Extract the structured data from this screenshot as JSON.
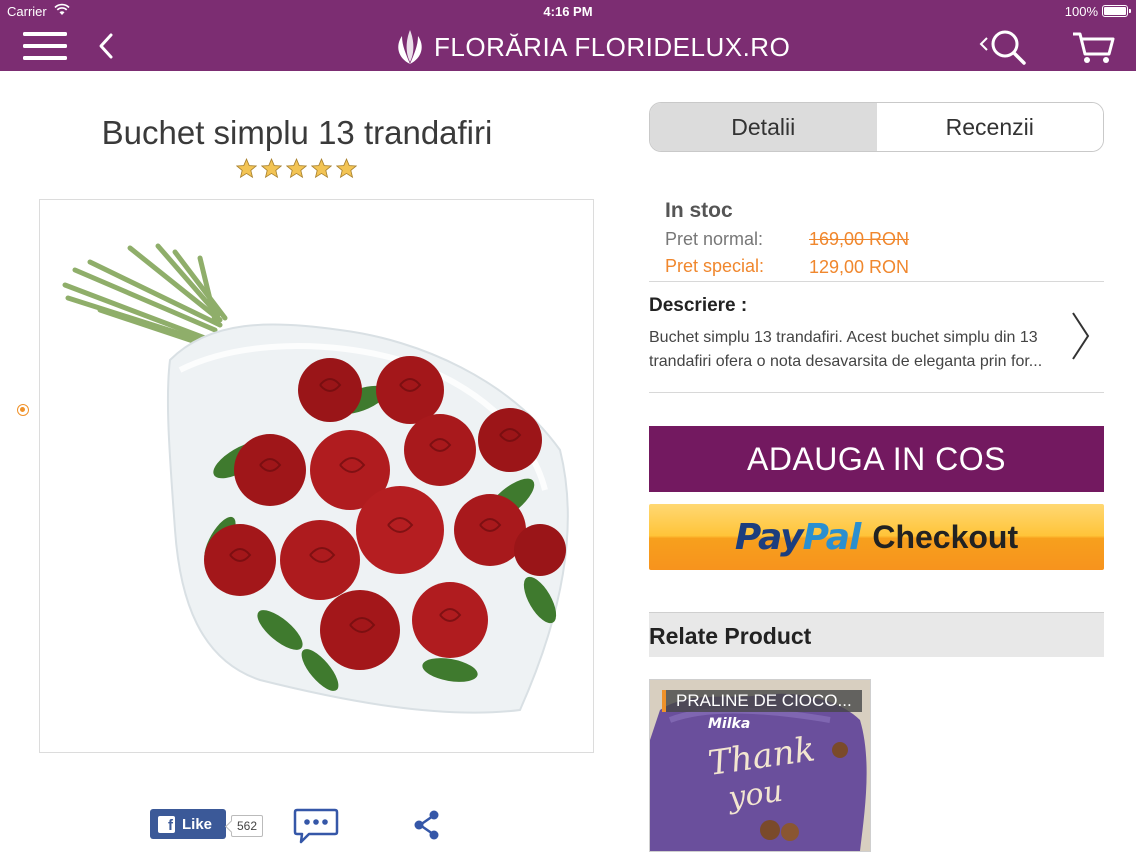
{
  "status_bar": {
    "carrier": "Carrier",
    "time": "4:16 PM",
    "battery": "100%"
  },
  "header": {
    "brand_name": "FLORĂRIA FLORIDELUX.RO",
    "icons": [
      "menu-icon",
      "back-icon",
      "logo-icon",
      "search-icon",
      "cart-icon"
    ],
    "background_color": "#7c2d72"
  },
  "product": {
    "title": "Buchet simplu 13 trandafiri",
    "rating": 5,
    "rating_max": 5,
    "page_indicator_count": 1
  },
  "social": {
    "like_label": "Like",
    "like_count": "562"
  },
  "tabs": [
    {
      "label": "Detalii",
      "active": true
    },
    {
      "label": "Recenzii",
      "active": false
    }
  ],
  "details": {
    "stock": "In stoc",
    "price_normal_label": "Pret normal:",
    "price_normal_value": "169,00 RON",
    "price_special_label": "Pret special:",
    "price_special_value": "129,00 RON",
    "description_title": "Descriere :",
    "description_text": "Buchet simplu 13 trandafiri. Acest buchet simplu din 13 trandafiri ofera o nota desavarsita de eleganta prin for..."
  },
  "actions": {
    "add_to_cart": "ADAUGA IN COS",
    "paypal_pay": "Pay",
    "paypal_pal": "Pal",
    "paypal_checkout": "Checkout",
    "add_to_cart_color": "#731960"
  },
  "related": {
    "title": "Relate Product",
    "items": [
      {
        "label": "PRALINE DE CIOCO..."
      }
    ]
  }
}
